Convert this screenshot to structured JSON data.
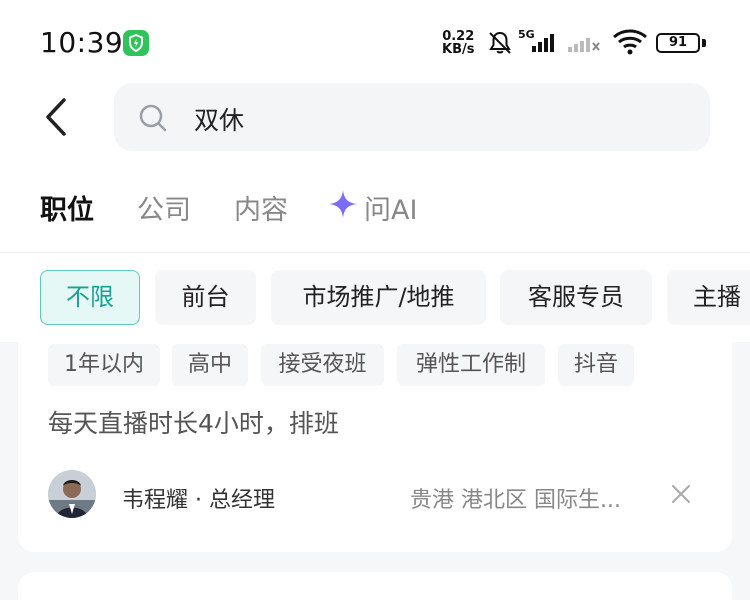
{
  "status_bar": {
    "time": "10:39",
    "net_speed_value": "0.22",
    "net_speed_unit": "KB/s",
    "network_type": "5G",
    "battery": "91",
    "accent_green": "#2fc45a"
  },
  "search": {
    "query": "双休"
  },
  "tabs": [
    {
      "label": "职位",
      "active": true
    },
    {
      "label": "公司",
      "active": false
    },
    {
      "label": "内容",
      "active": false
    },
    {
      "label": "问AI",
      "active": false
    }
  ],
  "filters": [
    {
      "label": "不限",
      "selected": true
    },
    {
      "label": "前台",
      "selected": false
    },
    {
      "label": "市场推广/地推",
      "selected": false
    },
    {
      "label": "客服专员",
      "selected": false
    },
    {
      "label": "主播",
      "selected": false
    }
  ],
  "job_card": {
    "tags": [
      "1年以内",
      "高中",
      "接受夜班",
      "弹性工作制",
      "抖音"
    ],
    "description": "每天直播时长4小时，排班",
    "recruiter": "韦程耀 · 总经理",
    "location": "贵港  港北区  国际生..."
  },
  "colors": {
    "chip_selected_bg": "#e6f8f6",
    "chip_selected_border": "#5ec8bd",
    "chip_selected_text": "#17a394",
    "ai_sparkle": "#7b6cf6"
  }
}
